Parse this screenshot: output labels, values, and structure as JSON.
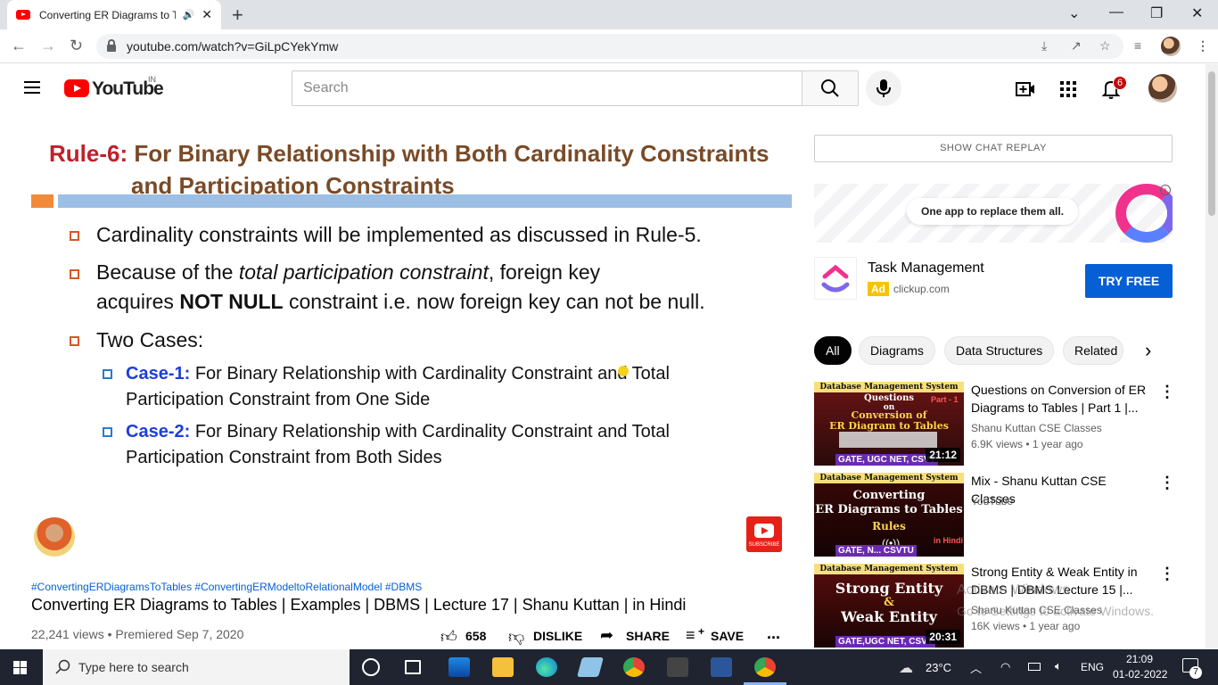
{
  "browser": {
    "tab_title": "Converting ER Diagrams to T",
    "new_tab": "+",
    "minimize": "—",
    "restore": "❐",
    "close": "✕",
    "collapse": "⌄",
    "url": "youtube.com/watch?v=GiLpCYekYmw"
  },
  "youtube": {
    "logo_text": "YouTube",
    "country": "IN",
    "search_placeholder": "Search",
    "notification_count": "6"
  },
  "slide": {
    "rule_label": "Rule-6:",
    "title_line1": " For Binary Relationship with Both Cardinality Constraints",
    "title_line2": "and Participation Constraints",
    "bullet1": "Cardinality constraints will be implemented as discussed in Rule-5.",
    "bullet2_a": "Because of the ",
    "bullet2_em": "total participation constraint",
    "bullet2_b": ", foreign key",
    "bullet2_c": "acquires ",
    "bullet2_strong": "NOT NULL",
    "bullet2_d": " constraint i.e. now foreign key can not be null.",
    "bullet3": "Two Cases:",
    "case1_label": "Case-1:",
    "case1_text": " For Binary Relationship with Cardinality Constraint and Total",
    "case1_text2": "Participation Constraint from One Side",
    "case2_label": "Case-2:",
    "case2_text": " For Binary Relationship with Cardinality Constraint and Total",
    "case2_text2": "Participation Constraint from Both Sides",
    "subscribe_label": "SUBSCRIBE"
  },
  "video": {
    "hashtags": "#ConvertingERDiagramsToTables #ConvertingERModeltoRelationalModel #DBMS",
    "title": "Converting ER Diagrams to Tables | Examples | DBMS | Lecture 17 | Shanu Kuttan | in Hindi",
    "views_date": "22,241 views • Premiered Sep 7, 2020",
    "likes": "658",
    "dislike": "DISLIKE",
    "share": "SHARE",
    "save": "SAVE",
    "more": "..."
  },
  "sidebar": {
    "chat_replay": "SHOW CHAT REPLAY",
    "ad_banner_text": "One app to replace them all.",
    "ad_title": "Task Management",
    "ad_tag": "Ad",
    "ad_domain": "clickup.com",
    "ad_button": "TRY FREE",
    "chips": [
      "All",
      "Diagrams",
      "Data Structures",
      "Related"
    ],
    "chip_next": "›",
    "related": [
      {
        "thumb_header": "Database Management System",
        "thumb_line1": "Questions",
        "thumb_line2": "on",
        "thumb_line3": "Conversion of",
        "thumb_line4": "ER Diagram to Tables",
        "thumb_part": "Part - 1",
        "thumb_footer": "GATE, UGC NET, CSVT",
        "duration": "21:12",
        "title": "Questions on Conversion of ER Diagrams to Tables | Part 1 |...",
        "channel": "Shanu Kuttan CSE Classes",
        "meta": "6.9K views • 1 year ago"
      },
      {
        "thumb_header": "Database Management System",
        "thumb_line1": "Converting",
        "thumb_line2": "ER Diagrams to Tables",
        "thumb_line3": "Rules",
        "thumb_footer": "GATE, N... CSVTU",
        "thumb_hindi": "in Hindi",
        "title": "Mix - Shanu Kuttan CSE Classes",
        "channel": "YouTube",
        "meta": ""
      },
      {
        "thumb_header": "Database Management System",
        "thumb_line1": "Strong Entity",
        "thumb_line2": "&",
        "thumb_line3": "Weak Entity",
        "thumb_footer": "GATE,UGC NET, CSVT",
        "duration": "20:31",
        "title": "Strong Entity & Weak Entity in DBMS | DBMS Lecture 15 |...",
        "channel": "Shanu Kuttan CSE Classes",
        "meta": "16K views • 1 year ago"
      }
    ]
  },
  "watermark": {
    "line1": "Activate Windows",
    "line2": "Go to Settings to activate Windows."
  },
  "taskbar": {
    "search_placeholder": "Type here to search",
    "weather": "23°C",
    "language": "ENG",
    "time": "21:09",
    "date": "01-02-2022",
    "notifications": "7"
  }
}
